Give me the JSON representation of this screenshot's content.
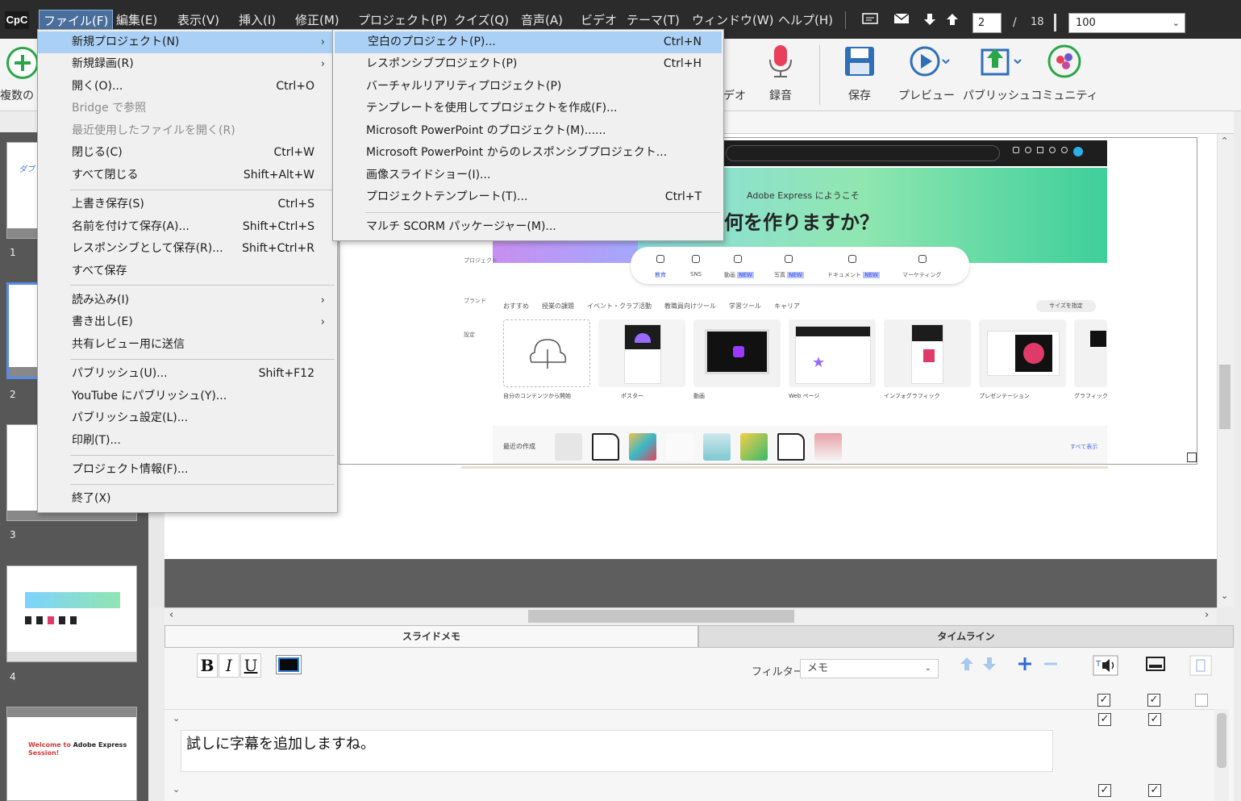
{
  "menubar": {
    "logo": "CpC",
    "items": [
      "ファイル(F)",
      "編集(E)",
      "表示(V)",
      "挿入(I)",
      "修正(M)",
      "プロジェクト(P)",
      "クイズ(Q)",
      "音声(A)",
      "ビデオ",
      "テーマ(T)",
      "ウィンドウ(W)",
      "ヘルプ(H)"
    ],
    "page_current": "2",
    "page_slash": "/",
    "page_total": "18",
    "zoom": "100"
  },
  "ribbon": {
    "partial_left_label": "複数の",
    "partial_video_label": "デオ",
    "buttons": [
      "録音",
      "保存",
      "プレビュー",
      "パブリッシュ",
      "コミュニティ"
    ]
  },
  "file_menu": {
    "items": [
      {
        "label": "新規プロジェクト(N)",
        "shortcut": "",
        "arrow": "›",
        "state": "highlighted"
      },
      {
        "label": "新規録画(R)",
        "shortcut": "",
        "arrow": "›",
        "state": ""
      },
      {
        "label": "開く(O)...",
        "shortcut": "Ctrl+O",
        "arrow": "",
        "state": ""
      },
      {
        "label": "Bridge で参照",
        "shortcut": "",
        "arrow": "",
        "state": "disabled"
      },
      {
        "label": "最近使用したファイルを開く(R)",
        "shortcut": "",
        "arrow": "",
        "state": "disabled"
      },
      {
        "label": "閉じる(C)",
        "shortcut": "Ctrl+W",
        "arrow": "",
        "state": ""
      },
      {
        "label": "すべて閉じる",
        "shortcut": "Shift+Alt+W",
        "arrow": "",
        "state": ""
      },
      {
        "label": "上書き保存(S)",
        "shortcut": "Ctrl+S",
        "arrow": "",
        "state": ""
      },
      {
        "label": "名前を付けて保存(A)...",
        "shortcut": "Shift+Ctrl+S",
        "arrow": "",
        "state": ""
      },
      {
        "label": "レスポンシブとして保存(R)...",
        "shortcut": "Shift+Ctrl+R",
        "arrow": "",
        "state": ""
      },
      {
        "label": "すべて保存",
        "shortcut": "",
        "arrow": "",
        "state": ""
      },
      {
        "label": "読み込み(I)",
        "shortcut": "",
        "arrow": "›",
        "state": ""
      },
      {
        "label": "書き出し(E)",
        "shortcut": "",
        "arrow": "›",
        "state": ""
      },
      {
        "label": "共有レビュー用に送信",
        "shortcut": "",
        "arrow": "",
        "state": ""
      },
      {
        "label": "パブリッシュ(U)...",
        "shortcut": "Shift+F12",
        "arrow": "",
        "state": ""
      },
      {
        "label": "YouTube にパブリッシュ(Y)...",
        "shortcut": "",
        "arrow": "",
        "state": ""
      },
      {
        "label": "パブリッシュ設定(L)...",
        "shortcut": "",
        "arrow": "",
        "state": ""
      },
      {
        "label": "印刷(T)...",
        "shortcut": "",
        "arrow": "",
        "state": ""
      },
      {
        "label": "プロジェクト情報(F)...",
        "shortcut": "",
        "arrow": "",
        "state": ""
      },
      {
        "label": "終了(X)",
        "shortcut": "",
        "arrow": "",
        "state": ""
      }
    ]
  },
  "new_project_submenu": {
    "items": [
      {
        "label": "空白のプロジェクト(P)...",
        "shortcut": "Ctrl+N",
        "state": "highlighted"
      },
      {
        "label": "レスポンシブプロジェクト(P)",
        "shortcut": "Ctrl+H",
        "state": ""
      },
      {
        "label": "バーチャルリアリティプロジェクト(P)",
        "shortcut": "",
        "state": ""
      },
      {
        "label": "テンプレートを使用してプロジェクトを作成(F)...",
        "shortcut": "",
        "state": ""
      },
      {
        "label": "Microsoft PowerPoint のプロジェクト(M)......",
        "shortcut": "",
        "state": ""
      },
      {
        "label": "Microsoft PowerPoint からのレスポンシブプロジェクト...",
        "shortcut": "",
        "state": ""
      },
      {
        "label": "画像スライドショー(I)...",
        "shortcut": "",
        "state": ""
      },
      {
        "label": "プロジェクトテンプレート(T)...",
        "shortcut": "Ctrl+T",
        "state": ""
      },
      {
        "label": "マルチ SCORM パッケージャー(M)...",
        "shortcut": "",
        "state": ""
      }
    ]
  },
  "filmstrip": {
    "slide_numbers": [
      "1",
      "2",
      "3",
      "4"
    ],
    "thumb1_text": "ダブ",
    "thumb5_title_red": "Welcome to",
    "thumb5_title_dark": "Adobe Express",
    "thumb5_title_red2": "Session!"
  },
  "slide_content": {
    "welcome": "Adobe Express にようこそ",
    "title": "何を作りますか？",
    "tabs": [
      "教育",
      "SNS",
      "動画",
      "写真",
      "ドキュメント",
      "マーケティング"
    ],
    "tab_new_badge": "NEW",
    "categories": "おすすめ　　授業の課題　　イベント・クラブ活動　　教職員向けツール　　学習ツール　　キャリア",
    "size_button": "サイズを指定",
    "cards": [
      "自分のコンテンツから開始",
      "ポスター",
      "動画",
      "Web ページ",
      "インフォグラフィック",
      "プレゼンテーション",
      "グラフィック"
    ],
    "recent": "最近の作成",
    "see_all": "すべて表示",
    "side_items": [
      "プロジェクト",
      "ブランド",
      "設定"
    ]
  },
  "panel": {
    "tab_notes": "スライドメモ",
    "tab_timeline": "タイムライン",
    "bold": "B",
    "italic": "I",
    "underline": "U",
    "filter_label": "フィルター",
    "filter_value": "メモ",
    "caption_text": "試しに字幕を追加しますね。"
  },
  "colors": {
    "menubar_bg": "#2b2b2b",
    "menu_highlight": "#aad0f6",
    "filmstrip_bg": "#575757",
    "accent_blue": "#2a7ad8"
  }
}
